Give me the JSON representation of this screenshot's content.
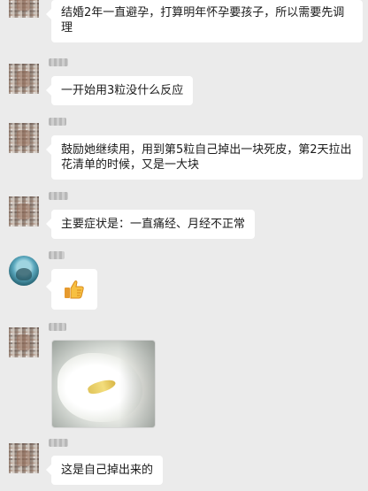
{
  "messages": [
    {
      "text": "结婚2年一直避孕，打算明年怀孕要孩子，所以需要先调理"
    },
    {
      "text": "一开始用3粒没什么反应"
    },
    {
      "text": "鼓励她继续用，用到第5粒自己掉出一块死皮，第2天拉出花清单的时候，又是一大块"
    },
    {
      "text": "主要症状是：一直痛经、月经不正常"
    },
    {
      "icon": "thumbs-up-icon"
    },
    {
      "image": "photo-of-expelled-tissue"
    },
    {
      "text": "这是自己掉出来的"
    }
  ],
  "colors": {
    "background": "#ebebeb",
    "bubble": "#ffffff",
    "text": "#1b1b1b"
  }
}
